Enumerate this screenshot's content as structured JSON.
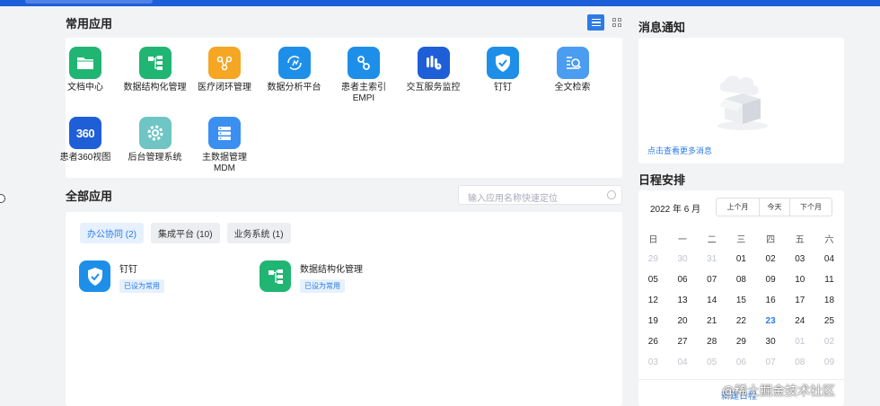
{
  "frequent": {
    "title": "常用应用",
    "apps": [
      {
        "label": "文档中心",
        "icon": "folder-icon",
        "color": "#21b573"
      },
      {
        "label": "数据结构化管理",
        "icon": "structure-icon",
        "color": "#21b573"
      },
      {
        "label": "医疗闭环管理",
        "icon": "loop-icon",
        "color": "#f5a623"
      },
      {
        "label": "数据分析平台",
        "icon": "analytics-icon",
        "color": "#1e8fe8"
      },
      {
        "label": "患者主索引EMPI",
        "icon": "link-icon",
        "color": "#1e8fe8"
      },
      {
        "label": "交互服务监控",
        "icon": "monitor-icon",
        "color": "#1e5fd8"
      },
      {
        "label": "钉钉",
        "icon": "shield-check-icon",
        "color": "#1e8fe8"
      },
      {
        "label": "全文检索",
        "icon": "search-doc-icon",
        "color": "#4a9df0"
      },
      {
        "label": "患者360视图",
        "icon": "360-icon",
        "color": "#1e5fd8",
        "text": "360"
      },
      {
        "label": "后台管理系统",
        "icon": "gear-icon",
        "color": "#6ec5c4"
      },
      {
        "label": "主数据管理MDM",
        "icon": "database-icon",
        "color": "#3a8ff0"
      }
    ],
    "labels_wrapped": {
      "4": [
        "患者主索引",
        "EMPI"
      ],
      "10": [
        "主数据管理",
        "MDM"
      ]
    }
  },
  "all": {
    "title": "全部应用",
    "search_placeholder": "输入应用名称快速定位",
    "tabs": [
      "办公协同 (2)",
      "集成平台 (10)",
      "业务系统 (1)"
    ],
    "apps": [
      {
        "name": "钉钉",
        "tag": "已设为常用",
        "icon": "shield-check-icon",
        "color": "#1e8fe8"
      },
      {
        "name": "数据结构化管理",
        "tag": "已设为常用",
        "icon": "structure-icon",
        "color": "#21b573"
      }
    ]
  },
  "notice": {
    "title": "消息通知",
    "more": "点击查看更多消息"
  },
  "schedule": {
    "title": "日程安排",
    "year_month": "2022 年 6 月",
    "nav": [
      "上个月",
      "今天",
      "下个月"
    ],
    "weekdays": [
      "日",
      "一",
      "二",
      "三",
      "四",
      "五",
      "六"
    ],
    "weeks": [
      [
        [
          "29",
          1
        ],
        [
          "30",
          1
        ],
        [
          "31",
          1
        ],
        [
          "01",
          0
        ],
        [
          "02",
          0
        ],
        [
          "03",
          0
        ],
        [
          "04",
          0
        ]
      ],
      [
        [
          "05",
          0
        ],
        [
          "06",
          0
        ],
        [
          "07",
          0
        ],
        [
          "08",
          0
        ],
        [
          "09",
          0
        ],
        [
          "10",
          0
        ],
        [
          "11",
          0
        ]
      ],
      [
        [
          "12",
          0
        ],
        [
          "13",
          0
        ],
        [
          "14",
          0
        ],
        [
          "15",
          0
        ],
        [
          "16",
          0
        ],
        [
          "17",
          0
        ],
        [
          "18",
          0
        ]
      ],
      [
        [
          "19",
          0
        ],
        [
          "20",
          0
        ],
        [
          "21",
          0
        ],
        [
          "22",
          0
        ],
        [
          "23",
          2
        ],
        [
          "24",
          0
        ],
        [
          "25",
          0
        ]
      ],
      [
        [
          "26",
          0
        ],
        [
          "27",
          0
        ],
        [
          "28",
          0
        ],
        [
          "29",
          0
        ],
        [
          "30",
          0
        ],
        [
          "01",
          1
        ],
        [
          "02",
          1
        ]
      ],
      [
        [
          "03",
          1
        ],
        [
          "04",
          1
        ],
        [
          "05",
          1
        ],
        [
          "06",
          1
        ],
        [
          "07",
          1
        ],
        [
          "08",
          1
        ],
        [
          "09",
          1
        ]
      ]
    ],
    "new_label": "新建日程"
  },
  "watermark": "@稀土掘金技术社区"
}
